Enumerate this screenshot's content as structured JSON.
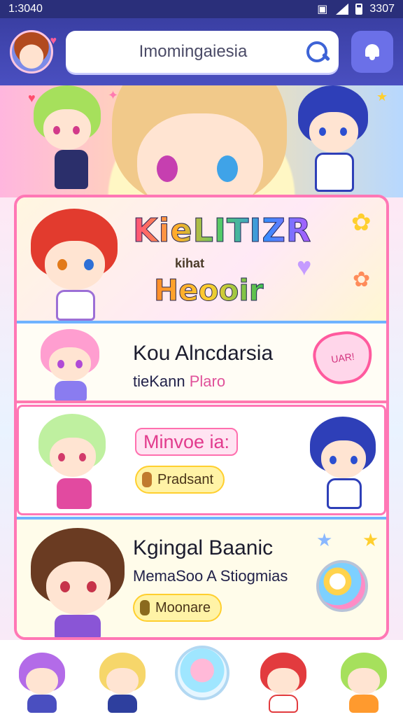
{
  "status": {
    "time": "1:3040",
    "right_text": "3307"
  },
  "header": {
    "search_text": "Imomingaiesia"
  },
  "cards": {
    "banner": {
      "title": "KieLITIZR",
      "small": "kihat",
      "subtitle": "Heooir"
    },
    "item1": {
      "title": "Kou Alncdarsia",
      "subtitle_a": "tieKann",
      "subtitle_b": "Plaro",
      "badge": "UAR!"
    },
    "item2": {
      "pill": "Minvoe ia:",
      "button": "Pradsant"
    },
    "item3": {
      "title": "Kgingal Baanic",
      "subtitle": "MemaSoo A Stiogmias",
      "button": "Moonare"
    }
  },
  "colors": {
    "primary": "#3a3fa3",
    "accent_pink": "#ff77b5",
    "accent_blue": "#6fb3ff",
    "accent_yellow": "#ffcf2e"
  },
  "icons": [
    "avatar",
    "search-icon",
    "bell-icon",
    "heart-badge",
    "orb-icon"
  ]
}
